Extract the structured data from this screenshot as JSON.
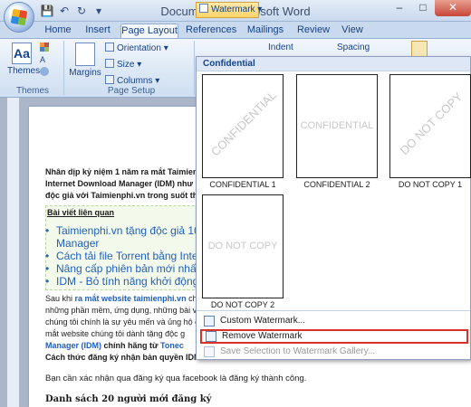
{
  "window": {
    "title": "Document2 - Microsoft Word",
    "min_label": "–",
    "max_label": "□",
    "close_label": "✕"
  },
  "tabs": [
    "Home",
    "Insert",
    "Page Layout",
    "References",
    "Mailings",
    "Review",
    "View"
  ],
  "ribbon": {
    "themes_group": {
      "themes_label": "Themes",
      "group_label": "Themes"
    },
    "page_setup_group": {
      "margins_label": "Margins",
      "orientation_label": "Orientation",
      "size_label": "Size",
      "columns_label": "Columns",
      "group_label": "Page Setup"
    },
    "watermark_label": "Watermark",
    "indent_label": "Indent",
    "spacing_label": "Spacing"
  },
  "gallery": {
    "header": "Confidential",
    "thumbs": [
      {
        "text": "CONFIDENTIAL",
        "label": "CONFIDENTIAL 1",
        "diagonal": true
      },
      {
        "text": "CONFIDENTIAL",
        "label": "CONFIDENTIAL 2",
        "diagonal": false
      },
      {
        "text": "DO NOT COPY",
        "label": "DO NOT COPY 1",
        "diagonal": true
      },
      {
        "text": "DO NOT COPY",
        "label": "DO NOT COPY 2",
        "diagonal": false
      }
    ],
    "menu": {
      "custom": "Custom Watermark...",
      "remove": "Remove Watermark",
      "save": "Save Selection to Watermark Gallery..."
    }
  },
  "document": {
    "para1_l1": "Nhân dịp kỷ niệm 1 năm ra mắt Taimien",
    "para1_l2": "Internet Download Manager (IDM) như m",
    "para1_l3": "độc giả với Taimienphi.vn trong suốt th",
    "related_heading": "Bài viết liên quan",
    "bullets": [
      "Taimienphi.vn tặng độc giả 100",
      "Manager",
      "Cách tải file Torrent bằng Intern",
      "Nâng cấp phiên bản mới nhất c",
      "IDM - Bỏ tính năng khởi động c"
    ],
    "para2_l1a": "Sau khi ",
    "para2_l1b": "ra mắt website taimienphi.vn",
    "para2_l1c": " chí",
    "para2_l2": "những phần mềm, ứng dụng, những bài v",
    "para2_l3": "chúng tôi chính là sự yêu mến và ủng hộ c",
    "para2_l4": "mắt website chúng tôi dành tặng độc g",
    "para2_l5a": "Manager (IDM)",
    "para2_l5b": " chính hãng từ ",
    "para2_l5c": "Tonec",
    "para2_l6": "Cách thức đăng ký nhận bản quyền IDM",
    "para3": "Bạn cần xác nhận qua đăng ký qua facebook là đăng ký thành công.",
    "heading2": "Danh sách 20 người mới đăng ký"
  }
}
